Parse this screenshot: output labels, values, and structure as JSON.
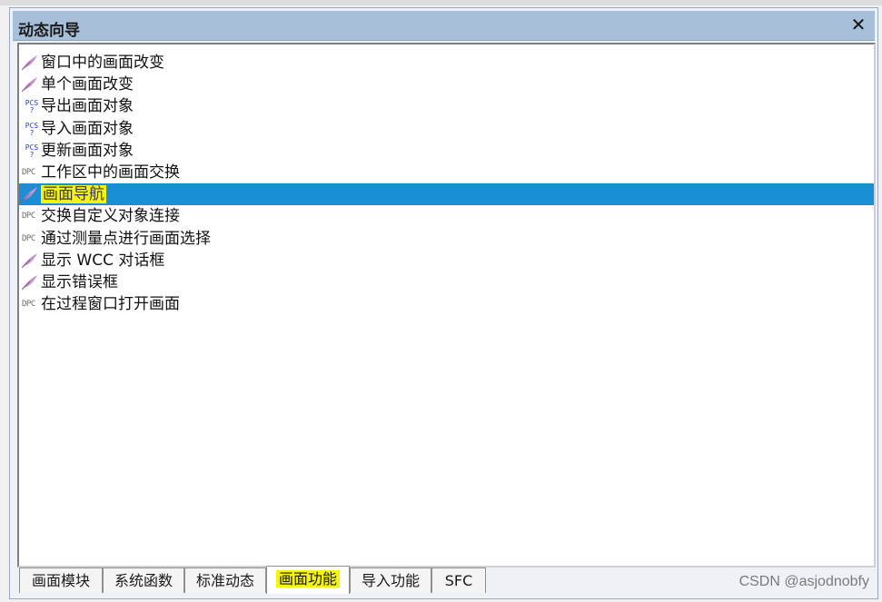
{
  "window": {
    "title": "动态向导",
    "close_glyph": "✕"
  },
  "list": {
    "items": [
      {
        "label": "窗口中的画面改变",
        "icon": "quill-icon"
      },
      {
        "label": "单个画面改变",
        "icon": "quill-icon"
      },
      {
        "label": "导出画面对象",
        "icon": "pcs-icon"
      },
      {
        "label": "导入画面对象",
        "icon": "pcs-icon"
      },
      {
        "label": "更新画面对象",
        "icon": "pcs-icon"
      },
      {
        "label": "工作区中的画面交换",
        "icon": "dpc-icon"
      },
      {
        "label": "画面导航",
        "icon": "quill-icon",
        "selected": true
      },
      {
        "label": "交换自定义对象连接",
        "icon": "dpc-icon"
      },
      {
        "label": "通过测量点进行画面选择",
        "icon": "dpc-icon"
      },
      {
        "label": "显示 WCC 对话框",
        "icon": "quill-icon"
      },
      {
        "label": "显示错误框",
        "icon": "quill-icon"
      },
      {
        "label": "在过程窗口打开画面",
        "icon": "dpc-icon"
      }
    ]
  },
  "icon_text": {
    "pcs": "PCS\n?",
    "dpc": "DPC"
  },
  "tabs": [
    {
      "label": "画面模块"
    },
    {
      "label": "系统函数"
    },
    {
      "label": "标准动态"
    },
    {
      "label": "画面功能",
      "active": true
    },
    {
      "label": "导入功能"
    },
    {
      "label": "SFC"
    }
  ],
  "watermark": "CSDN @asjodnobfy",
  "colors": {
    "selection": "#1a8fd6",
    "highlight": "#f5f214",
    "titlebar": "#a7bfd8"
  }
}
